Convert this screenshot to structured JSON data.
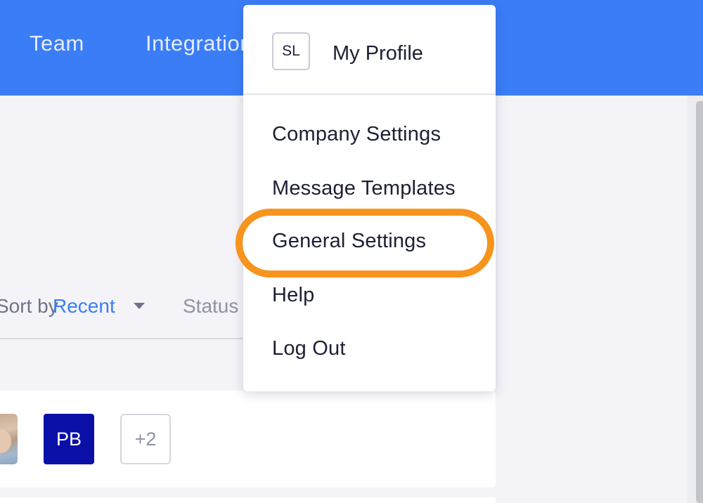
{
  "nav": {
    "tabs": [
      {
        "label": "Team"
      },
      {
        "label": "Integrations"
      }
    ]
  },
  "filters": {
    "sort_label": "Sort by",
    "sort_value": "Recent",
    "status_label": "Status"
  },
  "card": {
    "avatars": [
      {
        "type": "photo"
      },
      {
        "initials": "PB",
        "color": "#0a0fa8"
      },
      {
        "overflow_count": "+2"
      }
    ]
  },
  "dropdown": {
    "profile": {
      "initials": "SL",
      "label": "My Profile"
    },
    "items": [
      {
        "label": "Company Settings"
      },
      {
        "label": "Message Templates"
      },
      {
        "label": "General Settings",
        "highlighted": true
      },
      {
        "label": "Help"
      },
      {
        "label": "Log Out"
      }
    ]
  },
  "colors": {
    "topbar": "#3b7df6",
    "accent": "#3b7df6",
    "highlight": "#f7941d",
    "background": "#f4f4f8"
  }
}
